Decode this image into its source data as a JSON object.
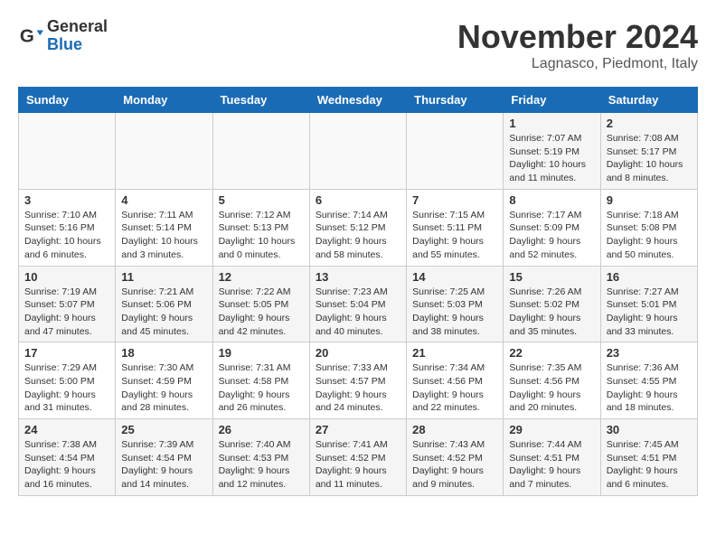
{
  "logo": {
    "general": "General",
    "blue": "Blue"
  },
  "title": "November 2024",
  "location": "Lagnasco, Piedmont, Italy",
  "weekdays": [
    "Sunday",
    "Monday",
    "Tuesday",
    "Wednesday",
    "Thursday",
    "Friday",
    "Saturday"
  ],
  "weeks": [
    [
      {
        "day": "",
        "info": ""
      },
      {
        "day": "",
        "info": ""
      },
      {
        "day": "",
        "info": ""
      },
      {
        "day": "",
        "info": ""
      },
      {
        "day": "",
        "info": ""
      },
      {
        "day": "1",
        "info": "Sunrise: 7:07 AM\nSunset: 5:19 PM\nDaylight: 10 hours and 11 minutes."
      },
      {
        "day": "2",
        "info": "Sunrise: 7:08 AM\nSunset: 5:17 PM\nDaylight: 10 hours and 8 minutes."
      }
    ],
    [
      {
        "day": "3",
        "info": "Sunrise: 7:10 AM\nSunset: 5:16 PM\nDaylight: 10 hours and 6 minutes."
      },
      {
        "day": "4",
        "info": "Sunrise: 7:11 AM\nSunset: 5:14 PM\nDaylight: 10 hours and 3 minutes."
      },
      {
        "day": "5",
        "info": "Sunrise: 7:12 AM\nSunset: 5:13 PM\nDaylight: 10 hours and 0 minutes."
      },
      {
        "day": "6",
        "info": "Sunrise: 7:14 AM\nSunset: 5:12 PM\nDaylight: 9 hours and 58 minutes."
      },
      {
        "day": "7",
        "info": "Sunrise: 7:15 AM\nSunset: 5:11 PM\nDaylight: 9 hours and 55 minutes."
      },
      {
        "day": "8",
        "info": "Sunrise: 7:17 AM\nSunset: 5:09 PM\nDaylight: 9 hours and 52 minutes."
      },
      {
        "day": "9",
        "info": "Sunrise: 7:18 AM\nSunset: 5:08 PM\nDaylight: 9 hours and 50 minutes."
      }
    ],
    [
      {
        "day": "10",
        "info": "Sunrise: 7:19 AM\nSunset: 5:07 PM\nDaylight: 9 hours and 47 minutes."
      },
      {
        "day": "11",
        "info": "Sunrise: 7:21 AM\nSunset: 5:06 PM\nDaylight: 9 hours and 45 minutes."
      },
      {
        "day": "12",
        "info": "Sunrise: 7:22 AM\nSunset: 5:05 PM\nDaylight: 9 hours and 42 minutes."
      },
      {
        "day": "13",
        "info": "Sunrise: 7:23 AM\nSunset: 5:04 PM\nDaylight: 9 hours and 40 minutes."
      },
      {
        "day": "14",
        "info": "Sunrise: 7:25 AM\nSunset: 5:03 PM\nDaylight: 9 hours and 38 minutes."
      },
      {
        "day": "15",
        "info": "Sunrise: 7:26 AM\nSunset: 5:02 PM\nDaylight: 9 hours and 35 minutes."
      },
      {
        "day": "16",
        "info": "Sunrise: 7:27 AM\nSunset: 5:01 PM\nDaylight: 9 hours and 33 minutes."
      }
    ],
    [
      {
        "day": "17",
        "info": "Sunrise: 7:29 AM\nSunset: 5:00 PM\nDaylight: 9 hours and 31 minutes."
      },
      {
        "day": "18",
        "info": "Sunrise: 7:30 AM\nSunset: 4:59 PM\nDaylight: 9 hours and 28 minutes."
      },
      {
        "day": "19",
        "info": "Sunrise: 7:31 AM\nSunset: 4:58 PM\nDaylight: 9 hours and 26 minutes."
      },
      {
        "day": "20",
        "info": "Sunrise: 7:33 AM\nSunset: 4:57 PM\nDaylight: 9 hours and 24 minutes."
      },
      {
        "day": "21",
        "info": "Sunrise: 7:34 AM\nSunset: 4:56 PM\nDaylight: 9 hours and 22 minutes."
      },
      {
        "day": "22",
        "info": "Sunrise: 7:35 AM\nSunset: 4:56 PM\nDaylight: 9 hours and 20 minutes."
      },
      {
        "day": "23",
        "info": "Sunrise: 7:36 AM\nSunset: 4:55 PM\nDaylight: 9 hours and 18 minutes."
      }
    ],
    [
      {
        "day": "24",
        "info": "Sunrise: 7:38 AM\nSunset: 4:54 PM\nDaylight: 9 hours and 16 minutes."
      },
      {
        "day": "25",
        "info": "Sunrise: 7:39 AM\nSunset: 4:54 PM\nDaylight: 9 hours and 14 minutes."
      },
      {
        "day": "26",
        "info": "Sunrise: 7:40 AM\nSunset: 4:53 PM\nDaylight: 9 hours and 12 minutes."
      },
      {
        "day": "27",
        "info": "Sunrise: 7:41 AM\nSunset: 4:52 PM\nDaylight: 9 hours and 11 minutes."
      },
      {
        "day": "28",
        "info": "Sunrise: 7:43 AM\nSunset: 4:52 PM\nDaylight: 9 hours and 9 minutes."
      },
      {
        "day": "29",
        "info": "Sunrise: 7:44 AM\nSunset: 4:51 PM\nDaylight: 9 hours and 7 minutes."
      },
      {
        "day": "30",
        "info": "Sunrise: 7:45 AM\nSunset: 4:51 PM\nDaylight: 9 hours and 6 minutes."
      }
    ]
  ]
}
